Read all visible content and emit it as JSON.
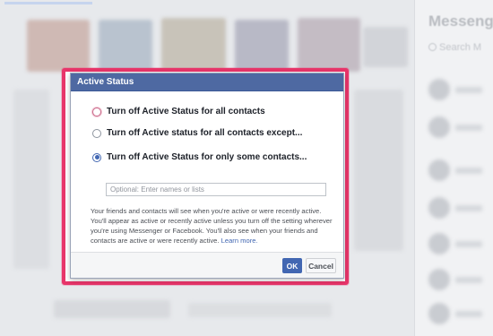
{
  "background": {
    "messenger_title": "Messeng",
    "messenger_search_placeholder": "Search M"
  },
  "dialog": {
    "title": "Active Status",
    "options": [
      {
        "label": "Turn off Active Status for all contacts",
        "checked": false,
        "focused": true
      },
      {
        "label": "Turn off Active status for all contacts except...",
        "checked": false,
        "focused": false
      },
      {
        "label": "Turn off Active Status for only some contacts...",
        "checked": true,
        "focused": false
      }
    ],
    "names_input": {
      "placeholder": "Optional: Enter names or lists",
      "value": ""
    },
    "description": "Your friends and contacts will see when you're active or were recently active. You'll appear as active or recently active unless you turn off the setting wherever you're using Messenger or Facebook. You'll also see when your friends and contacts are active or were recently active.",
    "learn_more": "Learn more.",
    "ok_label": "OK",
    "cancel_label": "Cancel"
  },
  "colors": {
    "highlight": "#e8356a",
    "header": "#4e69a2",
    "primary_button": "#4267b2"
  }
}
